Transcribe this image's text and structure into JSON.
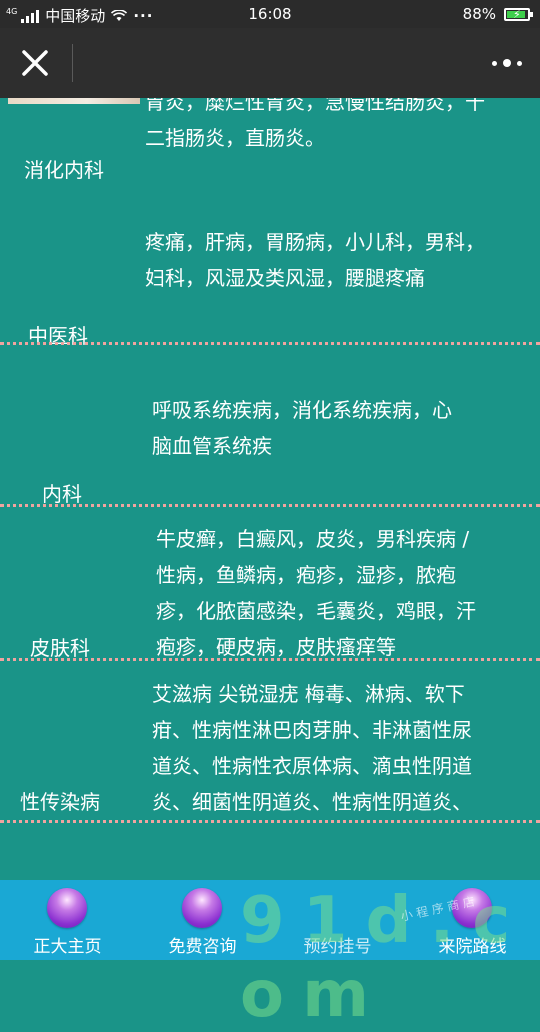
{
  "status": {
    "net_type": "4G",
    "carrier": "中国移动",
    "menu_dots": "···",
    "time": "16:08",
    "battery": "88%",
    "battery_level": 0.88
  },
  "header": {
    "close_icon": "close-icon",
    "more_icon": "more-icon"
  },
  "departments": [
    {
      "name": "消化内科",
      "desc_lines": [
        "胃炎，糜烂性胃炎，急慢性结肠炎，十",
        "二指肠炎，直肠炎。"
      ]
    },
    {
      "name": "中医科",
      "desc_lines": [
        "疼痛，肝病，胃肠病，小儿科，男科，",
        "妇科，风湿及类风湿，腰腿疼痛"
      ]
    },
    {
      "name": "内科",
      "desc_lines": [
        "呼吸系统疾病，消化系统疾病，心",
        "脑血管系统疾"
      ]
    },
    {
      "name": "皮肤科",
      "desc_lines": [
        "牛皮癣，白癜风，皮炎，男科疾病 /",
        "性病，鱼鳞病，疱疹，湿疹，脓疱",
        "疹，化脓菌感染，毛囊炎，鸡眼，汗",
        "疱疹，硬皮病，皮肤瘙痒等"
      ]
    },
    {
      "name": "性传染病",
      "desc_lines": [
        "艾滋病 尖锐湿疣 梅毒、淋病、软下",
        "疳、性病性淋巴肉芽肿、非淋菌性尿",
        "道炎、性病性衣原体病、滴虫性阴道",
        "炎、细菌性阴道炎、性病性阴道炎、"
      ]
    }
  ],
  "bottom_nav": [
    {
      "label": "正大主页"
    },
    {
      "label": "免费咨询"
    },
    {
      "label": "预约挂号"
    },
    {
      "label": "来院路线"
    }
  ],
  "watermark": {
    "text": "9 1 d . c o m",
    "sub": "小 程 序 商 店"
  },
  "colors": {
    "background": "#1a9488",
    "divider": "#f0a4a0",
    "bottom_bar": "#1aa8d4",
    "nav_ball": "#8a2fd0"
  }
}
